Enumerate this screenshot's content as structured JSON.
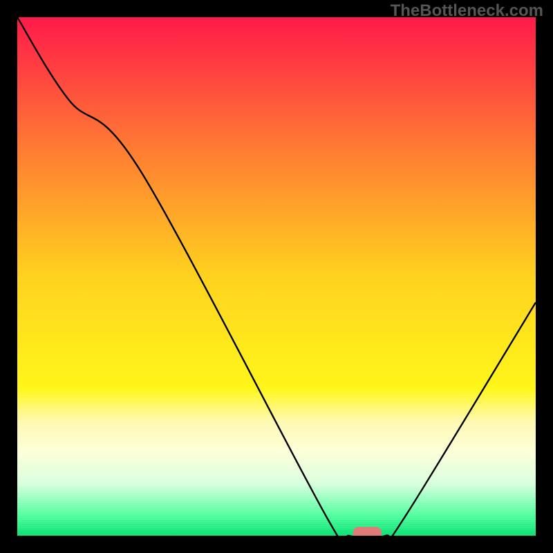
{
  "watermark": "TheBottleneck.com",
  "chart_data": {
    "type": "line",
    "title": "",
    "xlabel": "",
    "ylabel": "",
    "xlim": [
      0,
      100
    ],
    "ylim": [
      0,
      100
    ],
    "gradient_stops": [
      {
        "offset": 0.0,
        "color": "#ff1a4a"
      },
      {
        "offset": 0.25,
        "color": "#ff7a33"
      },
      {
        "offset": 0.5,
        "color": "#ffd21f"
      },
      {
        "offset": 0.72,
        "color": "#fff71a"
      },
      {
        "offset": 0.78,
        "color": "#fff9b0"
      },
      {
        "offset": 0.84,
        "color": "#fcffd8"
      },
      {
        "offset": 0.9,
        "color": "#d7ffdc"
      },
      {
        "offset": 0.96,
        "color": "#4dff9c"
      },
      {
        "offset": 1.0,
        "color": "#00e06f"
      }
    ],
    "series": [
      {
        "name": "bottleneck-curve",
        "x": [
          0,
          10,
          24,
          60,
          64,
          71,
          75,
          100
        ],
        "y": [
          100,
          84,
          70,
          3,
          0,
          0,
          4,
          45
        ]
      }
    ],
    "marker": {
      "x": 67.5,
      "y": 0.5,
      "color": "#e37a7a",
      "width": 5.5,
      "height": 2.4
    }
  }
}
